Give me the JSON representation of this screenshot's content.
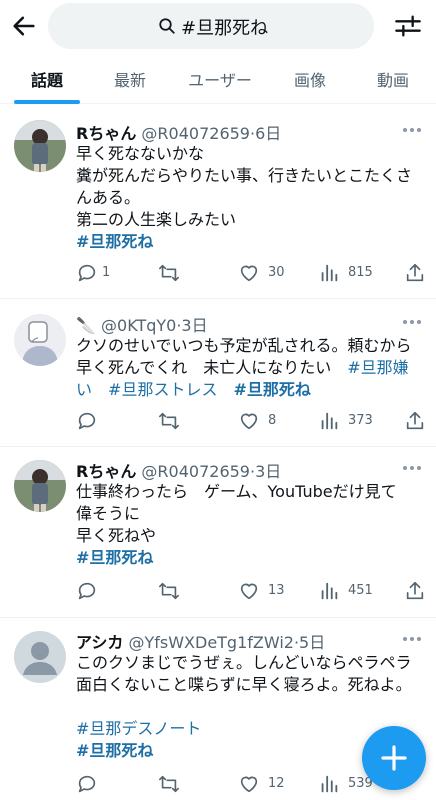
{
  "search": {
    "query": "#旦那死ね"
  },
  "tabs": [
    "話題",
    "最新",
    "ユーザー",
    "画像",
    "動画"
  ],
  "tweets": [
    {
      "name": "Rちゃん",
      "handle": "@R04072659",
      "time": "·6日",
      "lines": [
        "早く死なないかな",
        "糞が死んだらやりたい事、行きたいとこたくさ",
        "んある。",
        "第二の人生楽しみたい"
      ],
      "tags": "#旦那死ね",
      "replies": "1",
      "retweets": "",
      "likes": "30",
      "views": "815"
    },
    {
      "name": "🔪",
      "handle": "@0KTqY0",
      "time": "·3日",
      "lines": [
        "クソのせいでいつも予定が乱される。頼むから",
        "早く死んでくれ　未亡人になりたい"
      ],
      "tag_inline": "#旦那嫌",
      "line3_tags": [
        "い",
        "#旦那ストレス",
        "#旦那死ね"
      ],
      "replies": "",
      "retweets": "",
      "likes": "8",
      "views": "373"
    },
    {
      "name": "Rちゃん",
      "handle": "@R04072659",
      "time": "·3日",
      "lines": [
        "仕事終わったら　ゲーム、YouTubeだけ見て",
        "偉そうに",
        "早く死ねや"
      ],
      "tags": "#旦那死ね",
      "replies": "",
      "retweets": "",
      "likes": "13",
      "views": "451"
    },
    {
      "name": "アシカ",
      "handle": "@YfsWXDeTg1fZWi2",
      "time": "·5日",
      "lines": [
        "このクソまじでうぜぇ。しんどいならペラペラ",
        "面白くないこと喋らずに早く寝ろよ。死ねよ。"
      ],
      "tag1": "#旦那デスノート",
      "tag2": "#旦那死ね",
      "replies": "",
      "retweets": "",
      "likes": "12",
      "views": "539"
    }
  ],
  "colors": {
    "accent": "#1d9bf0",
    "hashtag": "#1d6fa5",
    "muted": "#536471"
  }
}
